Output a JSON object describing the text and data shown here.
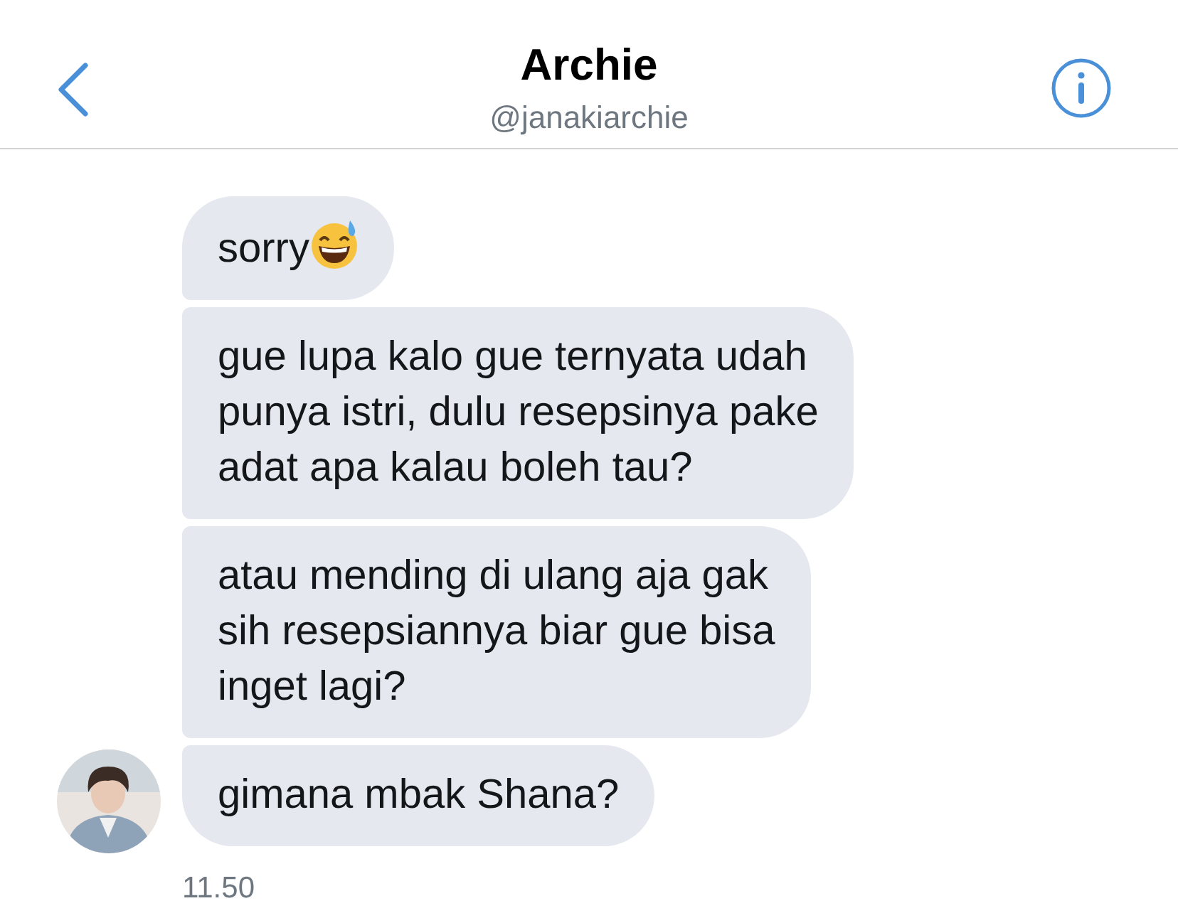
{
  "header": {
    "title": "Archie",
    "handle": "@janakiarchie"
  },
  "messages": [
    {
      "text": "sorry",
      "emoji": true
    },
    {
      "text": "gue lupa kalo gue ternyata udah\npunya istri, dulu resepsinya pake\nadat apa kalau boleh tau?",
      "emoji": false
    },
    {
      "text": "atau mending di ulang aja gak\nsih resepsiannya biar gue bisa\ninget lagi?",
      "emoji": false
    },
    {
      "text": "gimana mbak Shana?",
      "emoji": false
    }
  ],
  "timestamp": "11.50"
}
